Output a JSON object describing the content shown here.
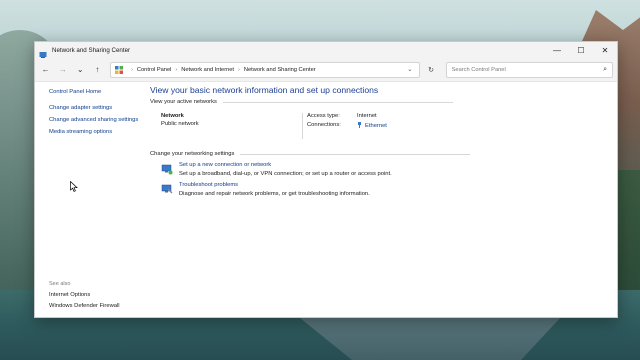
{
  "window": {
    "title": "Network and Sharing Center",
    "controls": {
      "minimize": "—",
      "maximize": "☐",
      "close": "✕"
    }
  },
  "navigation": {
    "back": "←",
    "forward": "→",
    "recent": "⌄",
    "up": "↑",
    "breadcrumbs": [
      "Control Panel",
      "Network and Internet",
      "Network and Sharing Center"
    ],
    "separator": "›",
    "dropdown": "⌄",
    "refresh": "↻",
    "search": {
      "placeholder": "Search Control Panel",
      "icon": "⌕"
    }
  },
  "sidebar": {
    "home": "Control Panel Home",
    "links": [
      "Change adapter settings",
      "Change advanced sharing settings",
      "Media streaming options"
    ],
    "see_also": {
      "header": "See also",
      "links": [
        "Internet Options",
        "Windows Defender Firewall"
      ]
    }
  },
  "main": {
    "heading": "View your basic network information and set up connections",
    "active_networks": {
      "header": "View your active networks",
      "network_name": "Network",
      "network_type": "Public network",
      "access_type_label": "Access type:",
      "access_type_value": "Internet",
      "connections_label": "Connections:",
      "connections_value": "Ethernet"
    },
    "networking_settings": {
      "header": "Change your networking settings",
      "tasks": [
        {
          "link": "Set up a new connection or network",
          "desc": "Set up a broadband, dial-up, or VPN connection; or set up a router or access point."
        },
        {
          "link": "Troubleshoot problems",
          "desc": "Diagnose and repair network problems, or get troubleshooting information."
        }
      ]
    }
  },
  "colors": {
    "link": "#0f3d8a",
    "heading": "#1c3f94"
  }
}
